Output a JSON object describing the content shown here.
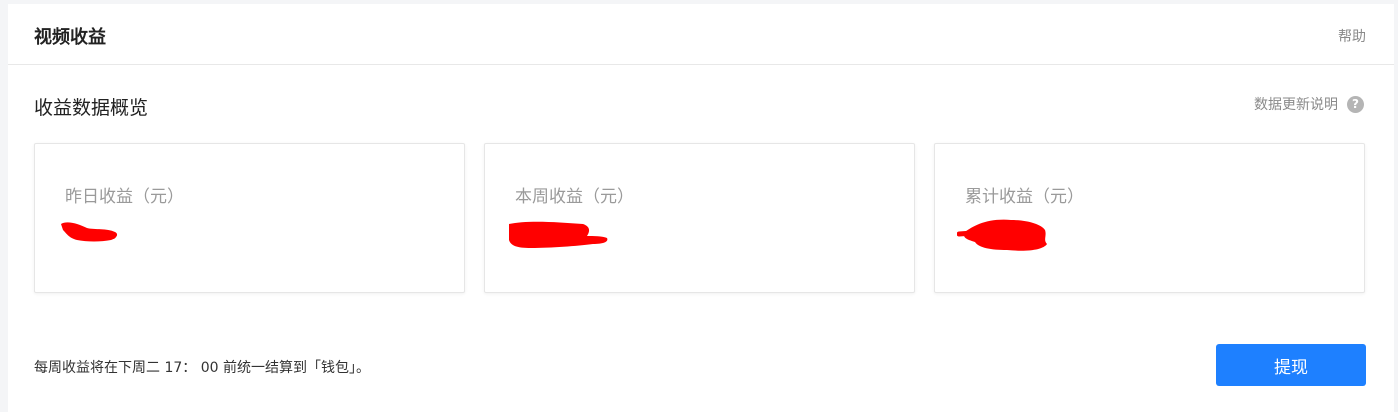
{
  "header": {
    "title": "视频收益",
    "help_label": "帮助"
  },
  "overview": {
    "title": "收益数据概览",
    "update_note_label": "数据更新说明",
    "help_icon": "question-circle-icon"
  },
  "cards": [
    {
      "label": "昨日收益（元）",
      "value_state": "redacted"
    },
    {
      "label": "本周收益（元）",
      "value_state": "redacted"
    },
    {
      "label": "累计收益（元）",
      "value_state": "redacted"
    }
  ],
  "footer": {
    "note": "每周收益将在下周二 17： 00 前统一结算到「钱包」。",
    "withdraw_label": "提现"
  },
  "colors": {
    "accent": "#1e80ff",
    "redaction": "#ff0000"
  }
}
